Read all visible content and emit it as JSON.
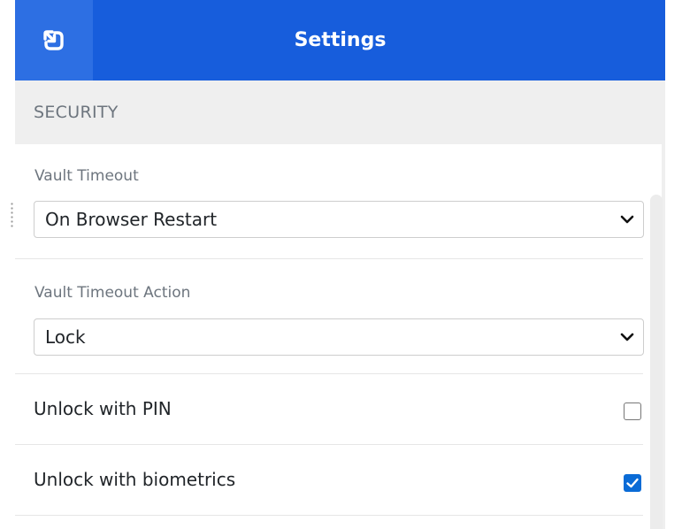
{
  "header": {
    "title": "Settings",
    "popout_icon": "popout-arrow-icon",
    "background": "#175ddc"
  },
  "security": {
    "section_label": "SECURITY",
    "vault_timeout": {
      "label": "Vault Timeout",
      "selected": "On Browser Restart"
    },
    "vault_timeout_action": {
      "label": "Vault Timeout Action",
      "selected": "Lock"
    },
    "unlock_pin": {
      "label": "Unlock with PIN",
      "checked": false
    },
    "unlock_biometrics": {
      "label": "Unlock with biometrics",
      "checked": true
    }
  },
  "colors": {
    "accent": "#175ddc",
    "checkbox_checked": "#0a6bd6",
    "section_text": "#6d757e"
  }
}
